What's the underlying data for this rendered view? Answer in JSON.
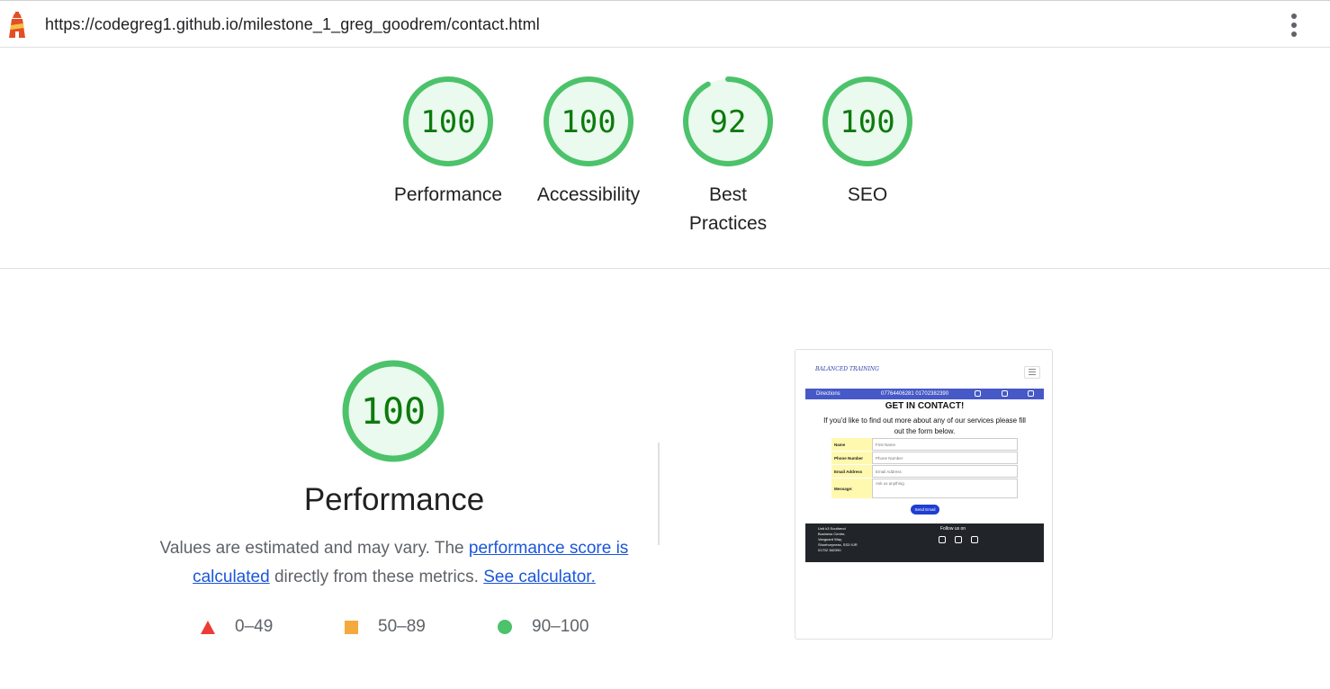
{
  "topbar": {
    "url": "https://codegreg1.github.io/milestone_1_greg_goodrem/contact.html",
    "logo_icon": "lighthouse-icon",
    "menu_icon": "kebab-menu-icon"
  },
  "categories": [
    {
      "score": "100",
      "label": "Performance",
      "value": 100
    },
    {
      "score": "100",
      "label": "Accessibility",
      "value": 100
    },
    {
      "score": "92",
      "label": "Best Practices",
      "value": 92
    },
    {
      "score": "100",
      "label": "SEO",
      "value": 100
    }
  ],
  "performance": {
    "score": "100",
    "value": 100,
    "title": "Performance",
    "desc_prefix": "Values are estimated and may vary. The ",
    "link1": "performance score is calculated",
    "desc_mid": " directly from these metrics. ",
    "link2": "See calculator.",
    "legend": [
      {
        "icon": "red-triangle-icon",
        "range": "0–49"
      },
      {
        "icon": "orange-square-icon",
        "range": "50–89"
      },
      {
        "icon": "green-circle-icon",
        "range": "90–100"
      }
    ]
  },
  "screenshot": {
    "logo": "BALANCED TRAINING",
    "nav_directions": "Directions",
    "nav_phones": "07764406281 01702382390",
    "heading": "GET IN CONTACT!",
    "subheading": "If you'd like to find out more about any of our services please fill out the form below.",
    "form": [
      {
        "label": "Name",
        "placeholder": "First Name"
      },
      {
        "label": "Phone Number",
        "placeholder": "Phone Number"
      },
      {
        "label": "Email Address",
        "placeholder": "Email Address"
      },
      {
        "label": "Message:",
        "placeholder": "Ask us anything"
      }
    ],
    "button": "Send Email",
    "footer_address": "Unit k3 Southend Business Centre, Vanguard Way, Shoeburyness, SS3 9JR",
    "footer_phone": "01702 382390",
    "footer_follow": "Follow us on"
  },
  "colors": {
    "pass_ring": "#4cc26a",
    "pass_fill": "#eafaee",
    "pass_text": "#0c7a0c",
    "link": "#1a56db",
    "fail": "#eb3d35",
    "average": "#f4a93c"
  }
}
